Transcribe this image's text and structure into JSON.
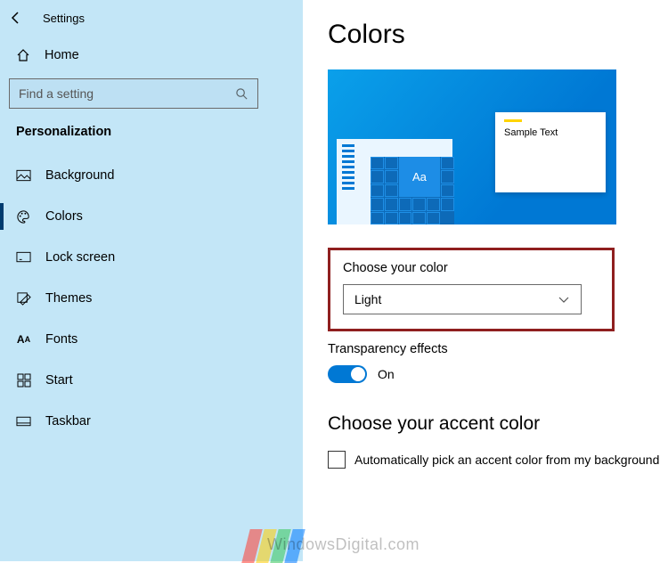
{
  "app": {
    "title": "Settings"
  },
  "sidebar": {
    "home": "Home",
    "search_placeholder": "Find a setting",
    "category": "Personalization",
    "items": [
      {
        "label": "Background",
        "icon": "picture-icon"
      },
      {
        "label": "Colors",
        "icon": "palette-icon"
      },
      {
        "label": "Lock screen",
        "icon": "lockscreen-icon"
      },
      {
        "label": "Themes",
        "icon": "themes-icon"
      },
      {
        "label": "Fonts",
        "icon": "fonts-icon"
      },
      {
        "label": "Start",
        "icon": "start-icon"
      },
      {
        "label": "Taskbar",
        "icon": "taskbar-icon"
      }
    ],
    "selected_index": 1
  },
  "main": {
    "title": "Colors",
    "preview": {
      "sample_text": "Sample Text",
      "tile_label": "Aa"
    },
    "choose_color": {
      "label": "Choose your color",
      "value": "Light"
    },
    "transparency": {
      "label": "Transparency effects",
      "state_text": "On",
      "on": true
    },
    "accent": {
      "heading": "Choose your accent color",
      "auto_label": "Automatically pick an accent color from my background",
      "auto_checked": false
    }
  },
  "watermark": "WindowsDigital.com"
}
